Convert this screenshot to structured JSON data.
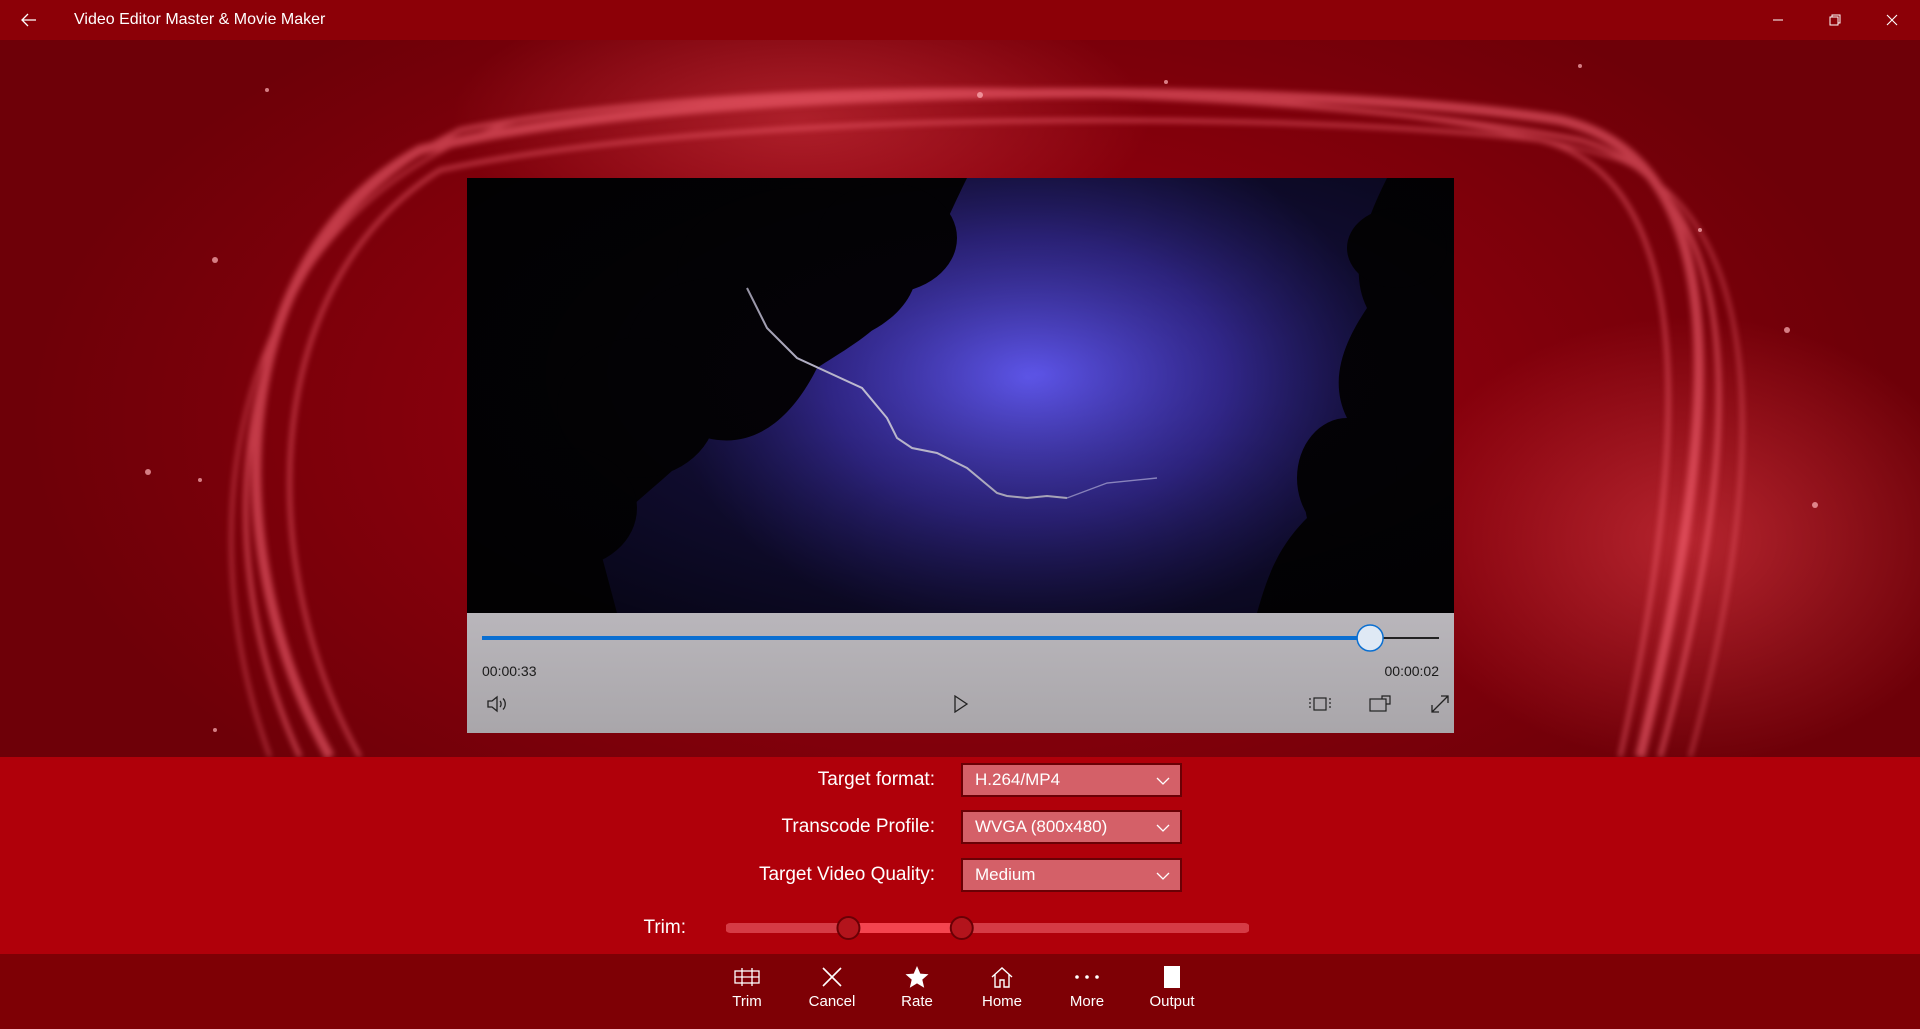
{
  "window": {
    "title": "Video Editor Master & Movie Maker"
  },
  "player": {
    "time_elapsed": "00:00:33",
    "time_remaining": "00:00:02",
    "progress": 0.928
  },
  "settings": {
    "target_format": {
      "label": "Target format:",
      "value": "H.264/MP4"
    },
    "transcode_profile": {
      "label": "Transcode Profile:",
      "value": "WVGA (800x480)"
    },
    "video_quality": {
      "label": "Target Video Quality:",
      "value": "Medium"
    },
    "trim": {
      "label": "Trim:",
      "start": 0.23,
      "end": 0.45
    }
  },
  "toolbar": {
    "trim": "Trim",
    "cancel": "Cancel",
    "rate": "Rate",
    "home": "Home",
    "more": "More",
    "output": "Output"
  },
  "colors": {
    "accent": "#0a6fd1",
    "titlebar": "#8c0007",
    "panel": "#b0000a",
    "toolbar": "#7e0005"
  }
}
